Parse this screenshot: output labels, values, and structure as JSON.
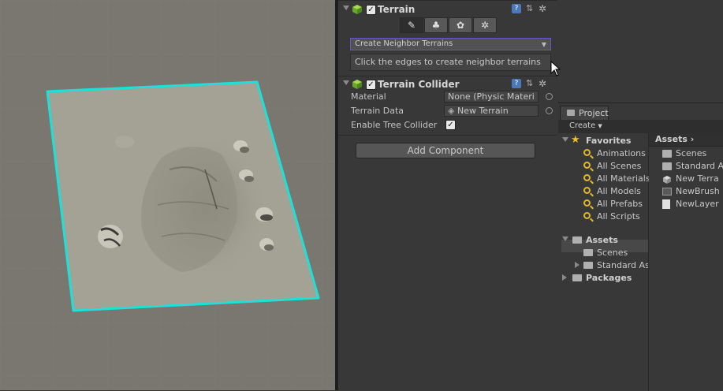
{
  "inspector": {
    "terrain": {
      "title": "Terrain",
      "enabled": true,
      "neighbor_dropdown": "Create Neighbor Terrains",
      "help_text": "Click the edges to create neighbor terrains"
    },
    "collider": {
      "title": "Terrain Collider",
      "enabled": true,
      "fields": [
        {
          "label": "Material",
          "value": "None (Physic Materi"
        },
        {
          "label": "Terrain Data",
          "value": "New Terrain"
        }
      ],
      "tree_label": "Enable Tree Collider",
      "tree_enabled": true
    },
    "add_component": "Add Component"
  },
  "project": {
    "tab": "Project",
    "create": "Create",
    "favorites_label": "Favorites",
    "favorites": [
      "Animations",
      "All Scenes",
      "All Materials",
      "All Models",
      "All Prefabs",
      "All Scripts"
    ],
    "assets_label": "Assets",
    "asset_folders": [
      "Scenes",
      "Standard As"
    ],
    "packages_label": "Packages",
    "breadcrumb": "Assets",
    "assets": [
      "Scenes",
      "Standard A",
      "New Terra",
      "NewBrush",
      "NewLayer"
    ]
  },
  "colors": {
    "selection_outline": "#1de0d8",
    "dropdown_border": "#6a53c8",
    "terrain": "#a3a294",
    "scene_bg": "#7a7670",
    "favorites_star": "#f0c020"
  }
}
